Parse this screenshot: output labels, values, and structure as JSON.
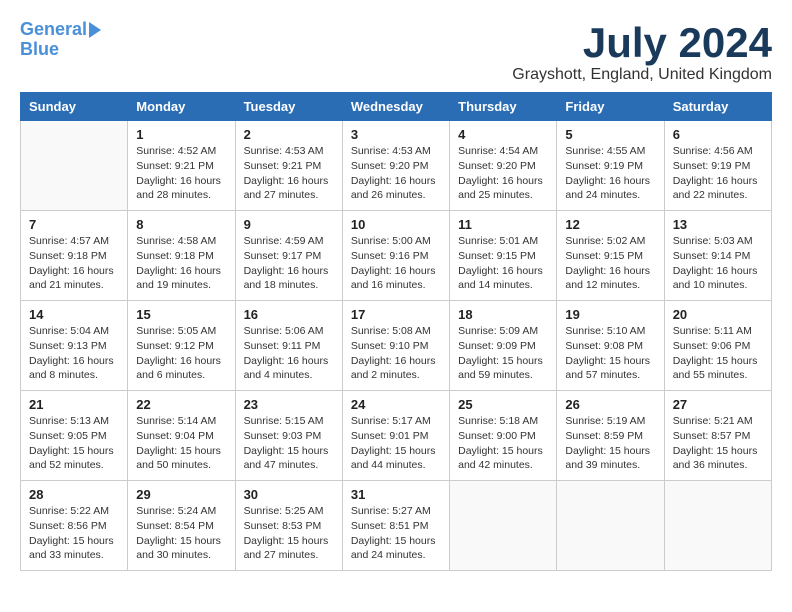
{
  "header": {
    "logo_line1": "General",
    "logo_line2": "Blue",
    "month_year": "July 2024",
    "location": "Grayshott, England, United Kingdom"
  },
  "days_of_week": [
    "Sunday",
    "Monday",
    "Tuesday",
    "Wednesday",
    "Thursday",
    "Friday",
    "Saturday"
  ],
  "weeks": [
    [
      {
        "day": "",
        "content": ""
      },
      {
        "day": "1",
        "content": "Sunrise: 4:52 AM\nSunset: 9:21 PM\nDaylight: 16 hours\nand 28 minutes."
      },
      {
        "day": "2",
        "content": "Sunrise: 4:53 AM\nSunset: 9:21 PM\nDaylight: 16 hours\nand 27 minutes."
      },
      {
        "day": "3",
        "content": "Sunrise: 4:53 AM\nSunset: 9:20 PM\nDaylight: 16 hours\nand 26 minutes."
      },
      {
        "day": "4",
        "content": "Sunrise: 4:54 AM\nSunset: 9:20 PM\nDaylight: 16 hours\nand 25 minutes."
      },
      {
        "day": "5",
        "content": "Sunrise: 4:55 AM\nSunset: 9:19 PM\nDaylight: 16 hours\nand 24 minutes."
      },
      {
        "day": "6",
        "content": "Sunrise: 4:56 AM\nSunset: 9:19 PM\nDaylight: 16 hours\nand 22 minutes."
      }
    ],
    [
      {
        "day": "7",
        "content": "Sunrise: 4:57 AM\nSunset: 9:18 PM\nDaylight: 16 hours\nand 21 minutes."
      },
      {
        "day": "8",
        "content": "Sunrise: 4:58 AM\nSunset: 9:18 PM\nDaylight: 16 hours\nand 19 minutes."
      },
      {
        "day": "9",
        "content": "Sunrise: 4:59 AM\nSunset: 9:17 PM\nDaylight: 16 hours\nand 18 minutes."
      },
      {
        "day": "10",
        "content": "Sunrise: 5:00 AM\nSunset: 9:16 PM\nDaylight: 16 hours\nand 16 minutes."
      },
      {
        "day": "11",
        "content": "Sunrise: 5:01 AM\nSunset: 9:15 PM\nDaylight: 16 hours\nand 14 minutes."
      },
      {
        "day": "12",
        "content": "Sunrise: 5:02 AM\nSunset: 9:15 PM\nDaylight: 16 hours\nand 12 minutes."
      },
      {
        "day": "13",
        "content": "Sunrise: 5:03 AM\nSunset: 9:14 PM\nDaylight: 16 hours\nand 10 minutes."
      }
    ],
    [
      {
        "day": "14",
        "content": "Sunrise: 5:04 AM\nSunset: 9:13 PM\nDaylight: 16 hours\nand 8 minutes."
      },
      {
        "day": "15",
        "content": "Sunrise: 5:05 AM\nSunset: 9:12 PM\nDaylight: 16 hours\nand 6 minutes."
      },
      {
        "day": "16",
        "content": "Sunrise: 5:06 AM\nSunset: 9:11 PM\nDaylight: 16 hours\nand 4 minutes."
      },
      {
        "day": "17",
        "content": "Sunrise: 5:08 AM\nSunset: 9:10 PM\nDaylight: 16 hours\nand 2 minutes."
      },
      {
        "day": "18",
        "content": "Sunrise: 5:09 AM\nSunset: 9:09 PM\nDaylight: 15 hours\nand 59 minutes."
      },
      {
        "day": "19",
        "content": "Sunrise: 5:10 AM\nSunset: 9:08 PM\nDaylight: 15 hours\nand 57 minutes."
      },
      {
        "day": "20",
        "content": "Sunrise: 5:11 AM\nSunset: 9:06 PM\nDaylight: 15 hours\nand 55 minutes."
      }
    ],
    [
      {
        "day": "21",
        "content": "Sunrise: 5:13 AM\nSunset: 9:05 PM\nDaylight: 15 hours\nand 52 minutes."
      },
      {
        "day": "22",
        "content": "Sunrise: 5:14 AM\nSunset: 9:04 PM\nDaylight: 15 hours\nand 50 minutes."
      },
      {
        "day": "23",
        "content": "Sunrise: 5:15 AM\nSunset: 9:03 PM\nDaylight: 15 hours\nand 47 minutes."
      },
      {
        "day": "24",
        "content": "Sunrise: 5:17 AM\nSunset: 9:01 PM\nDaylight: 15 hours\nand 44 minutes."
      },
      {
        "day": "25",
        "content": "Sunrise: 5:18 AM\nSunset: 9:00 PM\nDaylight: 15 hours\nand 42 minutes."
      },
      {
        "day": "26",
        "content": "Sunrise: 5:19 AM\nSunset: 8:59 PM\nDaylight: 15 hours\nand 39 minutes."
      },
      {
        "day": "27",
        "content": "Sunrise: 5:21 AM\nSunset: 8:57 PM\nDaylight: 15 hours\nand 36 minutes."
      }
    ],
    [
      {
        "day": "28",
        "content": "Sunrise: 5:22 AM\nSunset: 8:56 PM\nDaylight: 15 hours\nand 33 minutes."
      },
      {
        "day": "29",
        "content": "Sunrise: 5:24 AM\nSunset: 8:54 PM\nDaylight: 15 hours\nand 30 minutes."
      },
      {
        "day": "30",
        "content": "Sunrise: 5:25 AM\nSunset: 8:53 PM\nDaylight: 15 hours\nand 27 minutes."
      },
      {
        "day": "31",
        "content": "Sunrise: 5:27 AM\nSunset: 8:51 PM\nDaylight: 15 hours\nand 24 minutes."
      },
      {
        "day": "",
        "content": ""
      },
      {
        "day": "",
        "content": ""
      },
      {
        "day": "",
        "content": ""
      }
    ]
  ]
}
